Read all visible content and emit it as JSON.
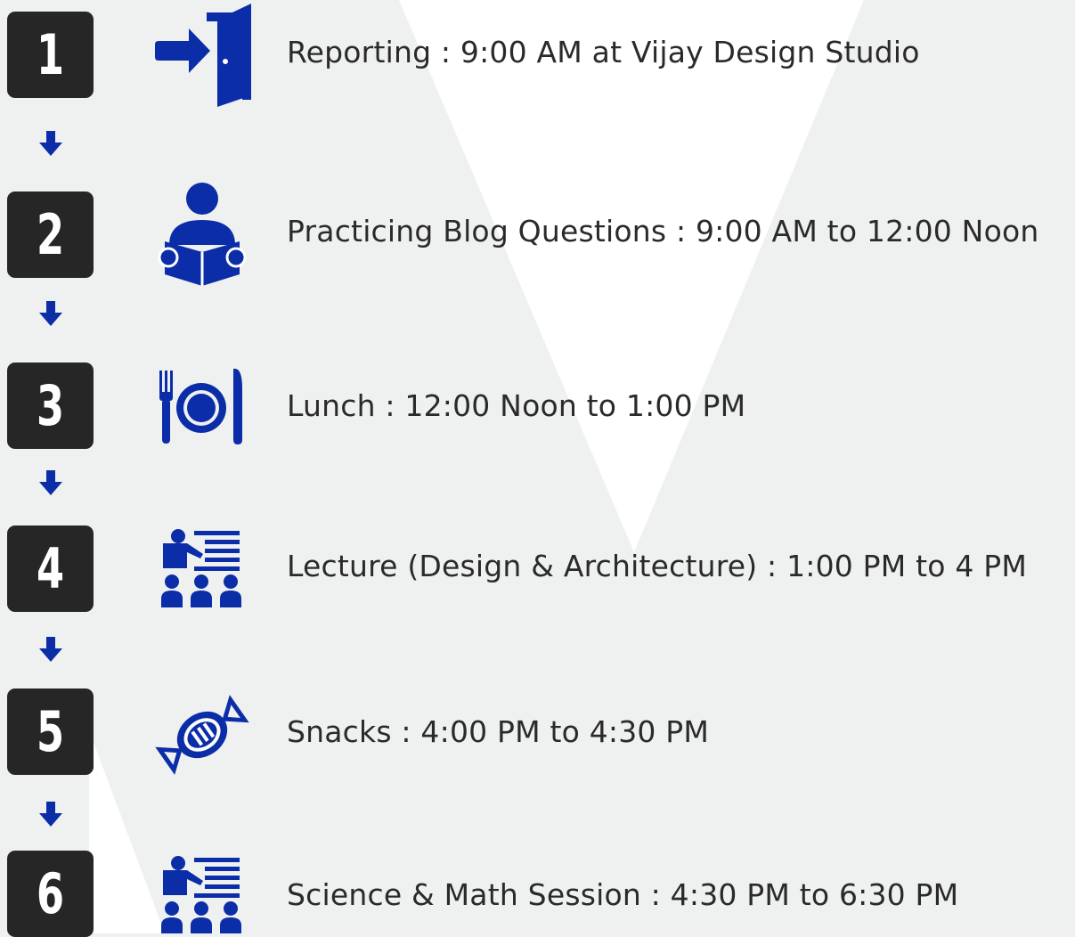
{
  "colors": {
    "background": "#eff0f0",
    "accent_triangle": "#ffffff",
    "badge": "#262626",
    "icon": "#0b2da8",
    "text": "#2a2a2a"
  },
  "steps": [
    {
      "number": "1",
      "icon": "door-enter-icon",
      "label": "Reporting : 9:00 AM at Vijay Design Studio"
    },
    {
      "number": "2",
      "icon": "person-reading-icon",
      "label": "Practicing Blog Questions : 9:00 AM to 12:00 Noon"
    },
    {
      "number": "3",
      "icon": "plate-cutlery-icon",
      "label": "Lunch : 12:00 Noon to 1:00 PM"
    },
    {
      "number": "4",
      "icon": "lecture-presentation-icon",
      "label": "Lecture (Design & Architecture) : 1:00 PM to 4 PM"
    },
    {
      "number": "5",
      "icon": "candy-icon",
      "label": "Snacks : 4:00 PM to 4:30 PM"
    },
    {
      "number": "6",
      "icon": "lecture-presentation-icon",
      "label": "Science & Math Session : 4:30 PM to 6:30 PM"
    }
  ]
}
